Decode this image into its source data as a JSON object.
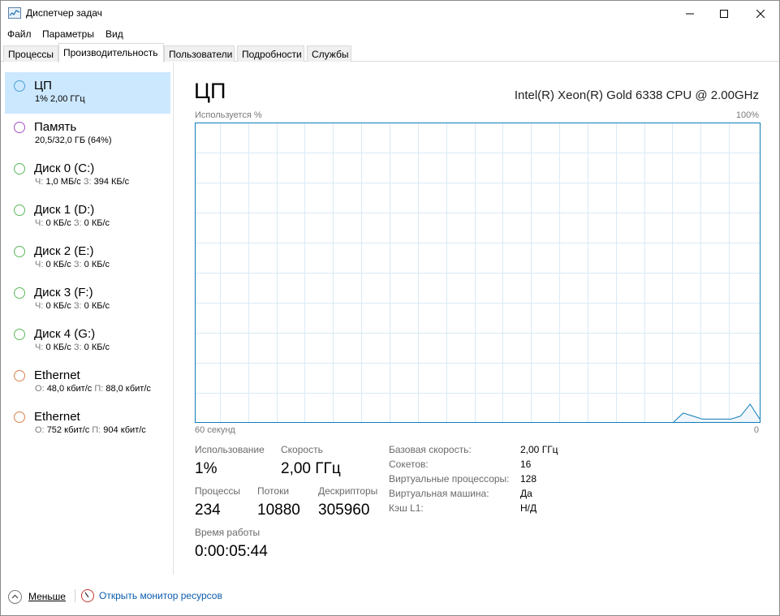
{
  "window": {
    "title": "Диспетчер задач"
  },
  "menu": {
    "file": "Файл",
    "params": "Параметры",
    "view": "Вид"
  },
  "tabs": [
    {
      "label": "Процессы",
      "active": false
    },
    {
      "label": "Производительность",
      "active": true
    },
    {
      "label": "Пользователи",
      "active": false
    },
    {
      "label": "Подробности",
      "active": false
    },
    {
      "label": "Службы",
      "active": false
    }
  ],
  "sidebar": {
    "items": [
      {
        "name": "ЦП",
        "detail": "1% 2,00 ГГц",
        "color": "#4a9fd6",
        "selected": true
      },
      {
        "name": "Память",
        "detail": "20,5/32,0 ГБ (64%)",
        "color": "#a64fc4",
        "selected": false
      },
      {
        "name": "Диск 0 (C:)",
        "r_label": "Ч:",
        "r_val": "1,0 МБ/с",
        "w_label": "З:",
        "w_val": "394 КБ/с",
        "color": "#5cb85c",
        "selected": false
      },
      {
        "name": "Диск 1 (D:)",
        "r_label": "Ч:",
        "r_val": "0 КБ/с",
        "w_label": "З:",
        "w_val": "0 КБ/с",
        "color": "#5cb85c",
        "selected": false
      },
      {
        "name": "Диск 2 (E:)",
        "r_label": "Ч:",
        "r_val": "0 КБ/с",
        "w_label": "З:",
        "w_val": "0 КБ/с",
        "color": "#5cb85c",
        "selected": false
      },
      {
        "name": "Диск 3 (F:)",
        "r_label": "Ч:",
        "r_val": "0 КБ/с",
        "w_label": "З:",
        "w_val": "0 КБ/с",
        "color": "#5cb85c",
        "selected": false
      },
      {
        "name": "Диск 4 (G:)",
        "r_label": "Ч:",
        "r_val": "0 КБ/с",
        "w_label": "З:",
        "w_val": "0 КБ/с",
        "color": "#5cb85c",
        "selected": false
      },
      {
        "name": "Ethernet",
        "r_label": "О:",
        "r_val": "48,0 кбит/с",
        "w_label": "П:",
        "w_val": "88,0 кбит/с",
        "color": "#d9814a",
        "selected": false
      },
      {
        "name": "Ethernet",
        "r_label": "О:",
        "r_val": "752 кбит/с",
        "w_label": "П:",
        "w_val": "904 кбит/с",
        "color": "#d9814a",
        "selected": false
      }
    ]
  },
  "main": {
    "title": "ЦП",
    "cpu_model": "Intel(R) Xeon(R) Gold 6338 CPU @ 2.00GHz",
    "graph_label_top_left": "Используется %",
    "graph_label_top_right": "100%",
    "graph_label_bottom_left": "60 секунд",
    "graph_label_bottom_right": "0",
    "stats": {
      "usage_label": "Использование",
      "usage_value": "1%",
      "speed_label": "Скорость",
      "speed_value": "2,00 ГГц",
      "processes_label": "Процессы",
      "processes_value": "234",
      "threads_label": "Потоки",
      "threads_value": "10880",
      "handles_label": "Дескрипторы",
      "handles_value": "305960",
      "uptime_label": "Время работы",
      "uptime_value": "0:00:05:44"
    },
    "details": [
      {
        "label": "Базовая скорость:",
        "value": "2,00 ГГц"
      },
      {
        "label": "Сокетов:",
        "value": "16"
      },
      {
        "label": "Виртуальные процессоры:",
        "value": "128"
      },
      {
        "label": "Виртуальная машина:",
        "value": "Да"
      },
      {
        "label": "Кэш L1:",
        "value": "Н/Д"
      }
    ]
  },
  "chart_data": {
    "type": "line",
    "title": "",
    "xlabel": "",
    "ylabel": "Используется %",
    "xlim": [
      60,
      0
    ],
    "ylim": [
      0,
      100
    ],
    "grid": true,
    "series": [
      {
        "values": [
          0,
          0,
          0,
          0,
          0,
          0,
          0,
          0,
          0,
          0,
          0,
          0,
          0,
          0,
          0,
          0,
          0,
          0,
          0,
          0,
          0,
          0,
          0,
          0,
          0,
          0,
          0,
          0,
          0,
          0,
          0,
          0,
          0,
          0,
          0,
          0,
          0,
          0,
          0,
          0,
          0,
          0,
          0,
          0,
          0,
          0,
          0,
          0,
          0,
          0,
          0,
          3,
          2,
          1,
          1,
          1,
          1,
          2,
          6,
          1
        ],
        "color": "#117dbb"
      }
    ]
  },
  "footer": {
    "less_label": "Меньше",
    "resmon_label": "Открыть монитор ресурсов"
  }
}
